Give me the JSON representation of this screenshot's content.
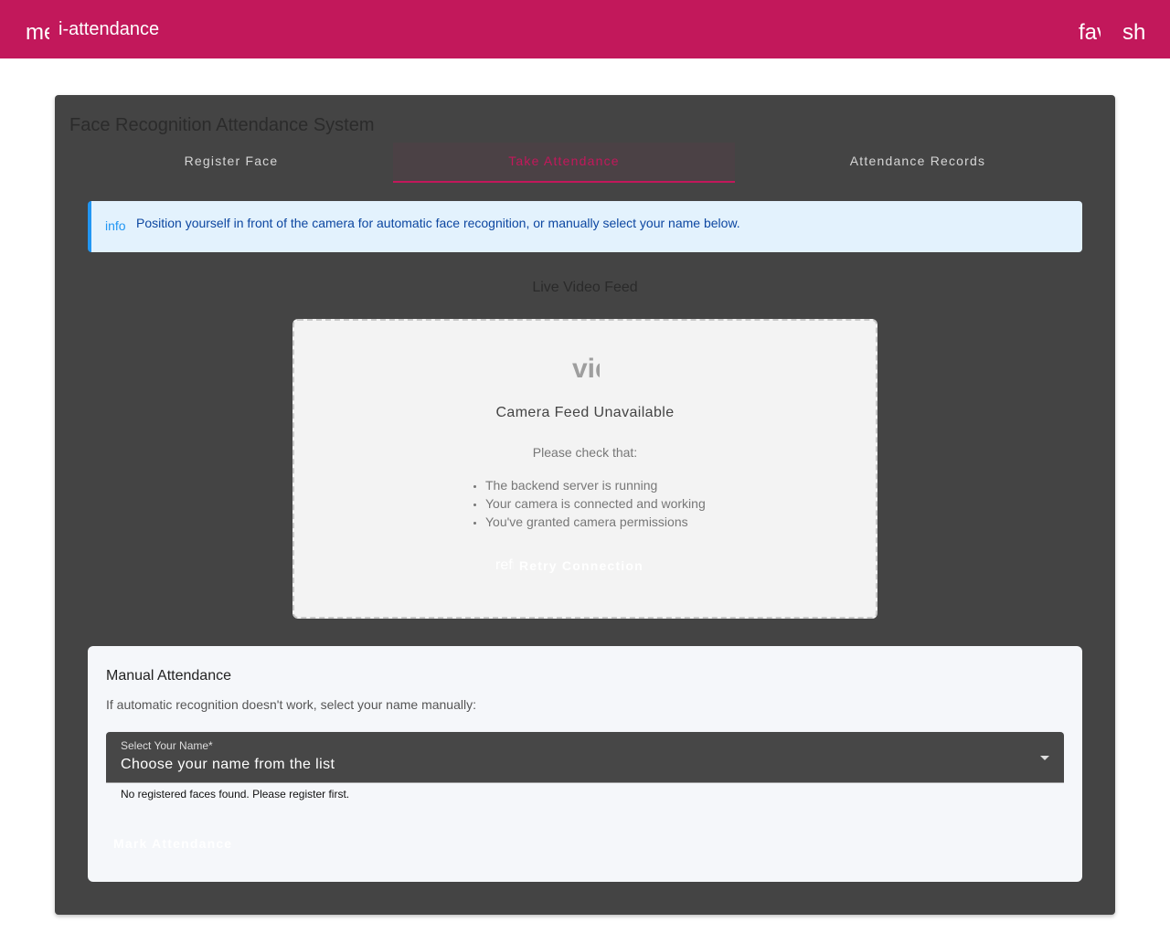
{
  "appbar": {
    "menu_icon_text": "menu",
    "title": "i-attendance",
    "fav_icon_text": "favorite",
    "share_icon_text": "share"
  },
  "main": {
    "title": "Face Recognition Attendance System",
    "tabs": [
      {
        "label": "Register Face"
      },
      {
        "label": "Take Attendance",
        "active": true
      },
      {
        "label": "Attendance Records"
      }
    ],
    "alert": {
      "icon_text": "info",
      "message": "Position yourself in front of the camera for automatic face recognition, or manually select your name below."
    },
    "live_feed_title": "Live Video Feed",
    "camera": {
      "icon_text": "videocam_off",
      "unavailable": "Camera Feed Unavailable",
      "check_text": "Please check that:",
      "checks": [
        "The backend server is running",
        "Your camera is connected and working",
        "You've granted camera permissions"
      ],
      "retry_icon_text": "refresh",
      "retry_label": "Retry Connection"
    },
    "manual": {
      "title": "Manual Attendance",
      "subtitle": "If automatic recognition doesn't work, select your name manually:",
      "select_label": "Select Your Name*",
      "select_value": "Choose your name from the list",
      "helper": "No registered faces found. Please register first.",
      "mark_button_label": "Mark Attendance"
    }
  },
  "colors": {
    "primary": "#c2185b",
    "card_bg": "#444444",
    "info_bg": "#e3f2fd",
    "info_accent": "#2196f3"
  }
}
